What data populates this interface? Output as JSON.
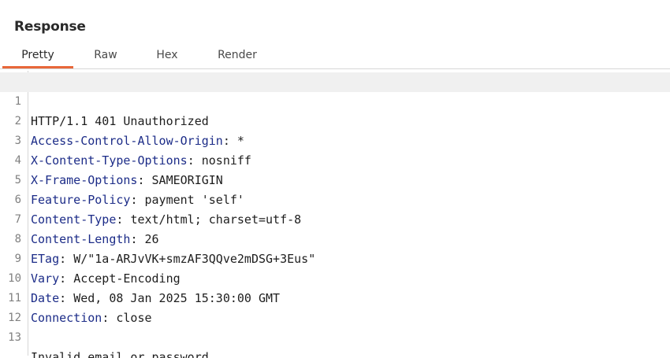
{
  "panel": {
    "title": "Response"
  },
  "tabs": [
    {
      "label": "Pretty",
      "active": true
    },
    {
      "label": "Raw",
      "active": false
    },
    {
      "label": "Hex",
      "active": false
    },
    {
      "label": "Render",
      "active": false
    }
  ],
  "colors": {
    "accent": "#e8673a",
    "header_name": "#1c2c88"
  },
  "lines": [
    {
      "num": "1",
      "text": "HTTP/1.1 401 Unauthorized"
    },
    {
      "num": "2",
      "name": "Access-Control-Allow-Origin",
      "sep": ": ",
      "value": "*"
    },
    {
      "num": "3",
      "name": "X-Content-Type-Options",
      "sep": ": ",
      "value": "nosniff"
    },
    {
      "num": "4",
      "name": "X-Frame-Options",
      "sep": ": ",
      "value": "SAMEORIGIN"
    },
    {
      "num": "5",
      "name": "Feature-Policy",
      "sep": ": ",
      "value": "payment 'self'"
    },
    {
      "num": "6",
      "name": "Content-Type",
      "sep": ": ",
      "value": "text/html; charset=utf-8"
    },
    {
      "num": "7",
      "name": "Content-Length",
      "sep": ": ",
      "value": "26"
    },
    {
      "num": "8",
      "name": "ETag",
      "sep": ": ",
      "value": "W/\"1a-ARJvVK+smzAF3QQve2mDSG+3Eus\""
    },
    {
      "num": "9",
      "name": "Vary",
      "sep": ": ",
      "value": "Accept-Encoding"
    },
    {
      "num": "10",
      "name": "Date",
      "sep": ": ",
      "value": "Wed, 08 Jan 2025 15:30:00 GMT"
    },
    {
      "num": "11",
      "name": "Connection",
      "sep": ": ",
      "value": "close"
    },
    {
      "num": "12",
      "text": ""
    },
    {
      "num": "13",
      "text": "Invalid email or password."
    }
  ]
}
